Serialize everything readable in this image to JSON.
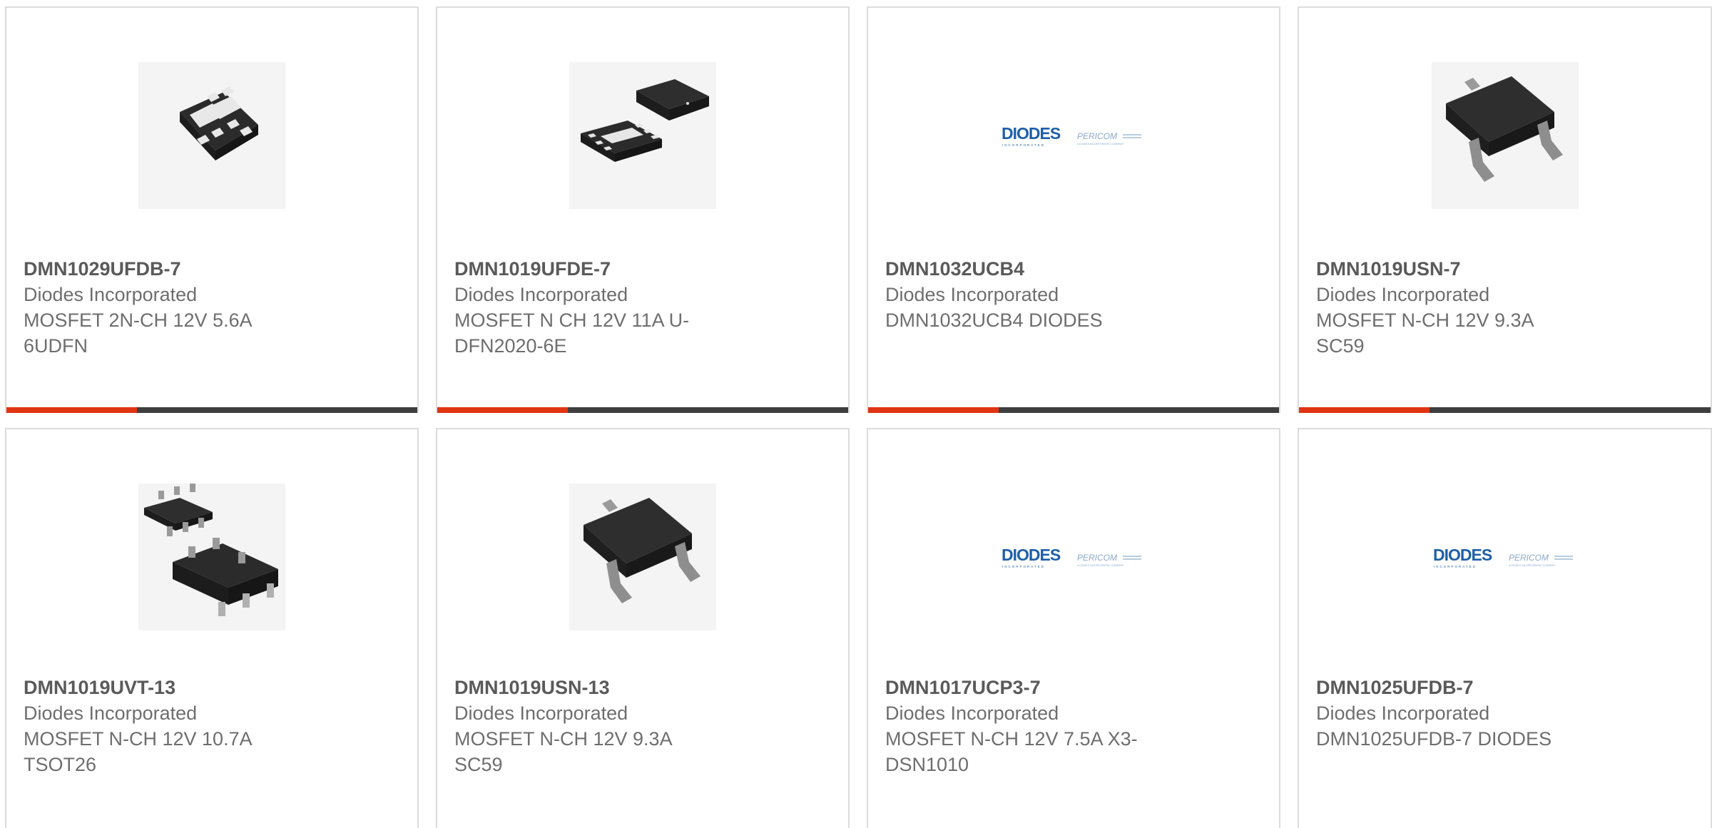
{
  "products": [
    {
      "part_number": "DMN1029UFDB-7",
      "manufacturer": "Diodes Incorporated",
      "description": "MOSFET 2N-CH 12V 5.6A 6UDFN",
      "image": "dfn6-dual-package-icon"
    },
    {
      "part_number": "DMN1019UFDE-7",
      "manufacturer": "Diodes Incorporated",
      "description": "MOSFET N CH 12V 11A U-DFN2020-6E",
      "image": "dfn6-package-icon"
    },
    {
      "part_number": "DMN1032UCB4",
      "manufacturer": "Diodes Incorporated",
      "description": "DMN1032UCB4 DIODES",
      "image": "diodes-pericom-logo"
    },
    {
      "part_number": "DMN1019USN-7",
      "manufacturer": "Diodes Incorporated",
      "description": "MOSFET N-CH 12V 9.3A SC59",
      "image": "sc59-package-icon"
    },
    {
      "part_number": "DMN1019UVT-13",
      "manufacturer": "Diodes Incorporated",
      "description": "MOSFET N-CH 12V 10.7A TSOT26",
      "image": "tsot26-package-icon"
    },
    {
      "part_number": "DMN1019USN-13",
      "manufacturer": "Diodes Incorporated",
      "description": "MOSFET N-CH 12V 9.3A SC59",
      "image": "sc59-package-icon"
    },
    {
      "part_number": "DMN1017UCP3-7",
      "manufacturer": "Diodes Incorporated",
      "description": "MOSFET N-CH 12V 7.5A X3-DSN1010",
      "image": "diodes-pericom-logo"
    },
    {
      "part_number": "DMN1025UFDB-7",
      "manufacturer": "Diodes Incorporated",
      "description": "DMN1025UFDB-7 DIODES",
      "image": "diodes-pericom-logo"
    }
  ],
  "colors": {
    "accent": "#e03412",
    "bar_dark": "#3e3e3e",
    "text": "#6e6e6e",
    "border": "#dcdcdc",
    "logo_blue": "#1e5fa8"
  },
  "logo_text": {
    "brand": "DIODES",
    "brand_sub": "INCORPORATED",
    "partner": "PERICOM",
    "partner_sub": "A DIODES INCORPORATED COMPANY"
  }
}
